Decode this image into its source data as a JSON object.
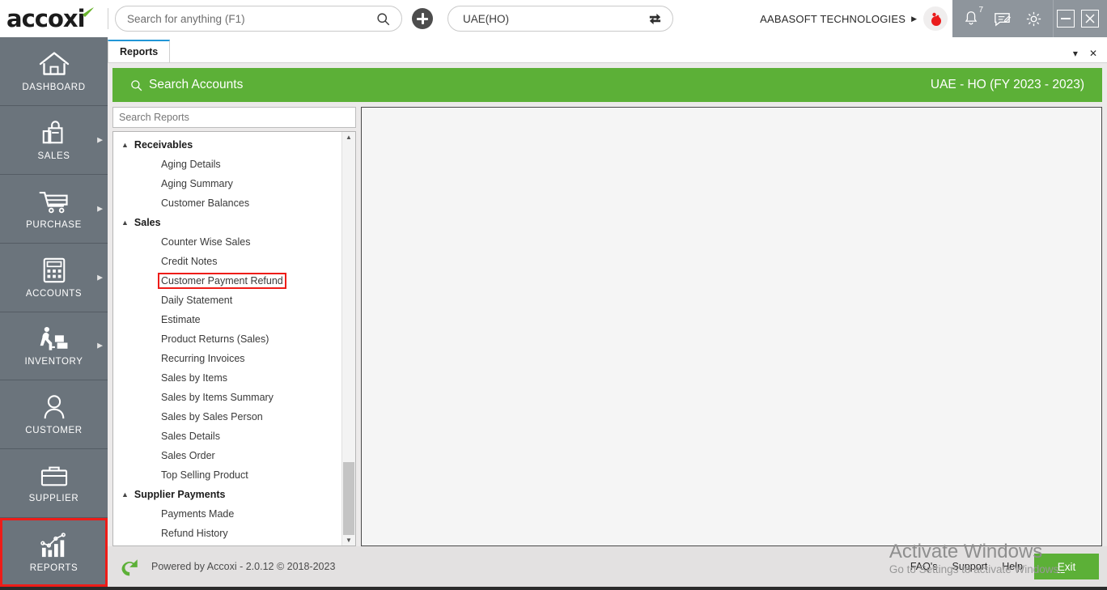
{
  "topbar": {
    "logo_text": "accoxi",
    "search": {
      "placeholder": "Search for anything (F1)",
      "value": ""
    },
    "add_button": "add-new",
    "branch": {
      "value": "UAE(HO)",
      "swap_icon": "swap-icon"
    },
    "company_name": "AABASOFT TECHNOLOGIES",
    "notification_count": "7",
    "icons": [
      "bell-icon",
      "message-icon",
      "gear-icon"
    ],
    "window_controls": [
      "minimize",
      "close"
    ]
  },
  "sidebar": {
    "items": [
      {
        "label": "DASHBOARD",
        "icon": "home-icon",
        "has_arrow": false,
        "highlight": false
      },
      {
        "label": "SALES",
        "icon": "shopping-bag-icon",
        "has_arrow": true,
        "highlight": false
      },
      {
        "label": "PURCHASE",
        "icon": "cart-icon",
        "has_arrow": true,
        "highlight": false
      },
      {
        "label": "ACCOUNTS",
        "icon": "calculator-icon",
        "has_arrow": true,
        "highlight": false
      },
      {
        "label": "INVENTORY",
        "icon": "warehouse-worker-icon",
        "has_arrow": true,
        "highlight": false
      },
      {
        "label": "CUSTOMER",
        "icon": "user-icon",
        "has_arrow": false,
        "highlight": false
      },
      {
        "label": "SUPPLIER",
        "icon": "briefcase-icon",
        "has_arrow": false,
        "highlight": false
      },
      {
        "label": "REPORTS",
        "icon": "bar-chart-icon",
        "has_arrow": false,
        "highlight": true
      }
    ]
  },
  "tabs": {
    "items": [
      {
        "label": "Reports",
        "active": true
      }
    ],
    "controls": [
      "tab-dropdown",
      "tab-close"
    ]
  },
  "content": {
    "header_title": "Search Accounts",
    "header_icon": "search-icon",
    "fiscal_year": "UAE - HO (FY 2023 - 2023)",
    "search_reports": {
      "placeholder": "Search Reports",
      "value": ""
    },
    "tree": [
      {
        "group": "Receivables",
        "expanded": true,
        "items": [
          {
            "label": "Aging Details",
            "highlight": false
          },
          {
            "label": "Aging Summary",
            "highlight": false
          },
          {
            "label": "Customer Balances",
            "highlight": false
          }
        ]
      },
      {
        "group": "Sales",
        "expanded": true,
        "items": [
          {
            "label": "Counter Wise Sales",
            "highlight": false
          },
          {
            "label": "Credit Notes",
            "highlight": false
          },
          {
            "label": "Customer Payment Refund",
            "highlight": true
          },
          {
            "label": "Daily Statement",
            "highlight": false
          },
          {
            "label": "Estimate",
            "highlight": false
          },
          {
            "label": "Product Returns (Sales)",
            "highlight": false
          },
          {
            "label": "Recurring Invoices",
            "highlight": false
          },
          {
            "label": "Sales by Items",
            "highlight": false
          },
          {
            "label": "Sales by Items Summary",
            "highlight": false
          },
          {
            "label": "Sales by Sales Person",
            "highlight": false
          },
          {
            "label": "Sales Details",
            "highlight": false
          },
          {
            "label": "Sales Order",
            "highlight": false
          },
          {
            "label": "Top Selling Product",
            "highlight": false
          }
        ]
      },
      {
        "group": "Supplier Payments",
        "expanded": true,
        "items": [
          {
            "label": "Payments Made",
            "highlight": false
          },
          {
            "label": "Refund History",
            "highlight": false
          }
        ]
      }
    ]
  },
  "footer": {
    "powered_by": "Powered by Accoxi - 2.0.12 © 2018-2023",
    "links": [
      "FAQ's",
      "Support",
      "Help"
    ],
    "exit_label": "Exit",
    "exit_accel": "E"
  },
  "watermark": {
    "line1": "Activate Windows",
    "line2": "Go to Settings to activate Windows."
  },
  "colors": {
    "accent_green": "#5cb037",
    "sidebar_gray": "#6b747c",
    "highlight_red": "#ee1c18",
    "sysbar_gray": "#8e959c"
  }
}
